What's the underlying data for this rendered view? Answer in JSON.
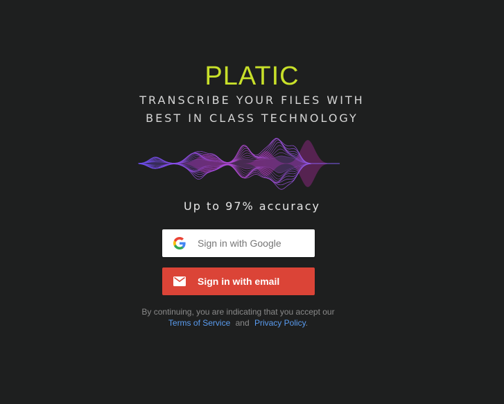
{
  "brand": {
    "name": "PLATIC",
    "color": "#c8e02a"
  },
  "tagline": {
    "line1": "TRANSCRIBE YOUR FILES WITH",
    "line2": "BEST IN CLASS TECHNOLOGY"
  },
  "waveform": {
    "icon": "soundwave-graphic",
    "colors": [
      "#6a4df0",
      "#b84bd8",
      "#8a2f7a"
    ]
  },
  "accuracy_text": "Up to 97% accuracy",
  "buttons": {
    "google": {
      "label": "Sign in with Google",
      "icon": "google-logo-icon"
    },
    "email": {
      "label": "Sign in with email",
      "icon": "envelope-icon",
      "color": "#db4437"
    }
  },
  "legal": {
    "prefix": "By continuing, you are indicating that you accept our",
    "terms_label": "Terms of Service",
    "conjunction": "and",
    "privacy_label": "Privacy Policy",
    "suffix": ".",
    "link_color": "#5a9cf0"
  }
}
